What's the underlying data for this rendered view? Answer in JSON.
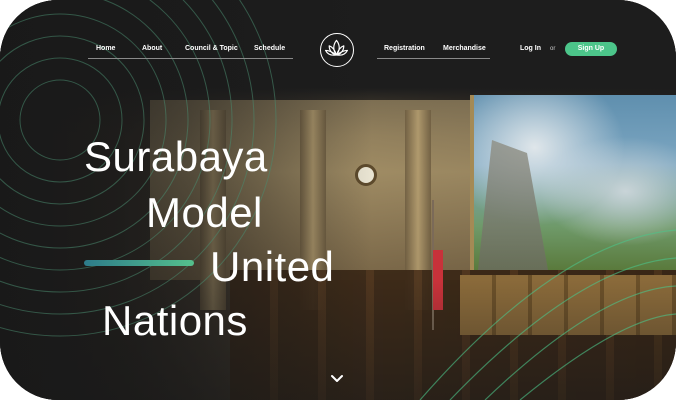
{
  "nav": {
    "left": [
      "Home",
      "About",
      "Council & Topic",
      "Schedule"
    ],
    "right": [
      "Registration",
      "Merchandise"
    ],
    "login": "Log In",
    "or": "or",
    "signup": "Sign Up"
  },
  "hero": {
    "line1": "Surabaya",
    "line2": "Model",
    "line3": "United",
    "line4": "Nations"
  },
  "colors": {
    "accent": "#4cc58a",
    "background": "#1c1c1c",
    "bar_start": "#2d7b8a",
    "bar_end": "#55c08c"
  },
  "icons": {
    "logo": "lotus-logo-icon",
    "scroll": "chevron-down-icon"
  }
}
